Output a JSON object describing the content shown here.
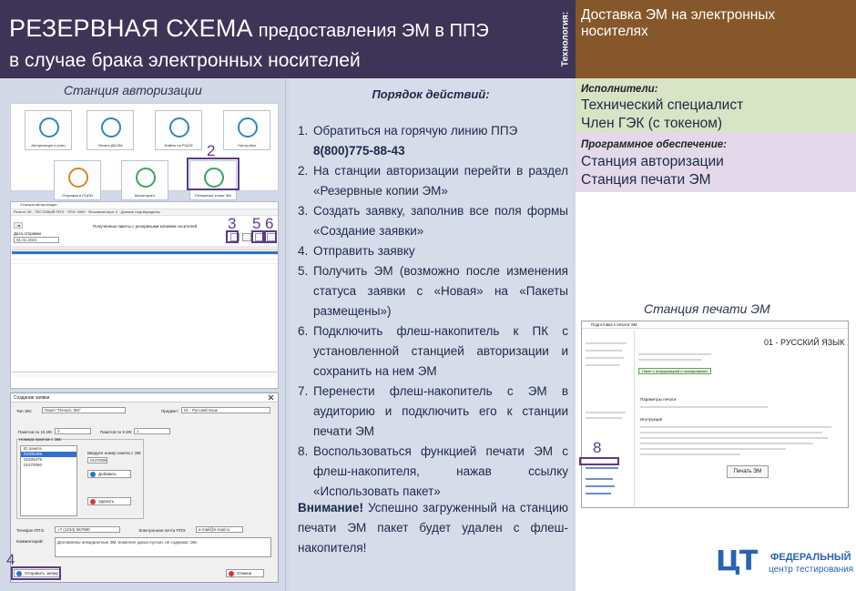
{
  "header": {
    "title_big": "РЕЗЕРВНАЯ СХЕМА",
    "title_mid": "предоставления ЭМ в ППЭ",
    "title_line2": "в случае брака электронных носителей",
    "vertical_label": "Технология:",
    "technology": "Доставка ЭМ на электронных носителях"
  },
  "left": {
    "caption": "Станция авторизации",
    "tiles": [
      {
        "label": "Авторизация и ключ",
        "icon": "key-icon"
      },
      {
        "label": "Печать ДБ/ЭМ",
        "icon": "printer-icon"
      },
      {
        "label": "Файлы на РЦОИ",
        "icon": "files-icon"
      },
      {
        "label": "Настройки",
        "icon": "gear-icon"
      },
      {
        "label": "Отправка в РЦОИ",
        "icon": "upload-icon"
      },
      {
        "label": "Мониторинг",
        "icon": "check-icon"
      },
      {
        "label": "Резервные копии ЭМ",
        "icon": "copy-icon"
      }
    ],
    "markers": {
      "m2": "2",
      "m3": "3",
      "m5": "5",
      "m6": "6",
      "m4": "4"
    },
    "win_title": "Станция авторизации",
    "win_bar": "Регион: 90 - ТЕСТОВЫЙ ППЭ · ППЭ: 9999 · № компьютера: 0 · Данные подтверждены",
    "win_heading": "Полученные пакеты с резервными копиями носителей",
    "date_label": "Дата отправки",
    "date_value": "01.01.2021",
    "dialog": {
      "title": "Создание заявки",
      "type_label": "Тип ЭМ:",
      "type_value": "Пакет \"Печать ЭМ\"",
      "subject_label": "Предмет:",
      "subject_value": "01 - Русский язык",
      "packets15_label": "Пакетов по 15 ИК:",
      "packets15_value": "2",
      "packets5_label": "Пакетов по 5 ИК:",
      "packets5_value": "1",
      "numbers_label": "Номера пакетов с ЭМ:",
      "list_header": "ID пакета",
      "list_items": [
        "01005499",
        "01005475",
        "01070090"
      ],
      "enter_label": "Введите номер пакета с ЭМ",
      "enter_value": "01070090",
      "add_button": "Добавить",
      "delete_button": "Удалить",
      "phone_label": "Телефон ППЭ:",
      "phone_value": "+7 (1234) 567890",
      "email_label": "Электронная почта ППЭ:",
      "email_value": "e-mail@e-mail.ru",
      "comment_label": "Комментарий:",
      "comment_value": "Доставлены некорректные ЭМ. Комплект диска пустые, не содержат ЭМ.",
      "send_button": "Отправить заявку",
      "cancel_button": "Отмена"
    }
  },
  "middle": {
    "title": "Порядок действий:",
    "steps": [
      {
        "n": "1.",
        "text": "Обратиться на горячую линию ППЭ",
        "phone": "8(800)775-88-43"
      },
      {
        "n": "2.",
        "text": "На станции авторизации перейти в раздел «Резервные копии ЭМ»"
      },
      {
        "n": "3.",
        "text": "Создать заявку, заполнив все поля формы «Создание заявки»"
      },
      {
        "n": "4.",
        "text": "Отправить заявку"
      },
      {
        "n": "5.",
        "text": "Получить ЭМ (возможно после изменения статуса заявки с «Новая» на «Пакеты размещены»)"
      },
      {
        "n": "6.",
        "text": "Подключить флеш-накопитель к ПК с установленной станцией авторизации и сохранить на нем ЭМ"
      },
      {
        "n": "7.",
        "text": "Перенести флеш-накопитель с ЭМ в аудиторию и подключить его к станции печати ЭМ"
      },
      {
        "n": "8.",
        "text": "Воспользоваться функцией печати ЭМ с флеш-накопителя, нажав ссылку «Использовать пакет»"
      }
    ],
    "warning_label": "Внимание!",
    "warning_text": "Успешно загруженный на станцию печати ЭМ пакет будет удален с флеш-накопителя!"
  },
  "right": {
    "performers_label": "Исполнители:",
    "performers": [
      "Технический специалист",
      "Член ГЭК (с токеном)"
    ],
    "software_label": "Программное обеспечение:",
    "software": [
      "Станция авторизации",
      "Станция печати ЭМ"
    ],
    "print_caption": "Станция печати ЭМ",
    "print_window": {
      "title": "Подготовка к печати ЭМ",
      "subject": "01 - РУССКИЙ ЯЗЫК",
      "banner": "Пакет с информацией о сканировании",
      "params": "Параметры печати",
      "instruction": "Инструкция",
      "print_button": "Печать ЭМ",
      "marker": "8"
    },
    "logo": {
      "mark": "ЦТ",
      "line1": "ФЕДЕРАЛЬНЫЙ",
      "line2": "центр тестирования"
    }
  },
  "colors": {
    "header_bg": "#3d3457",
    "tech_bg": "#87572c",
    "column_bg": "#d4d9e7",
    "performers_bg": "#d9e3c6",
    "software_bg": "#e3d9ea",
    "marker": "#5b3a8c",
    "logo": "#2a64b0"
  }
}
